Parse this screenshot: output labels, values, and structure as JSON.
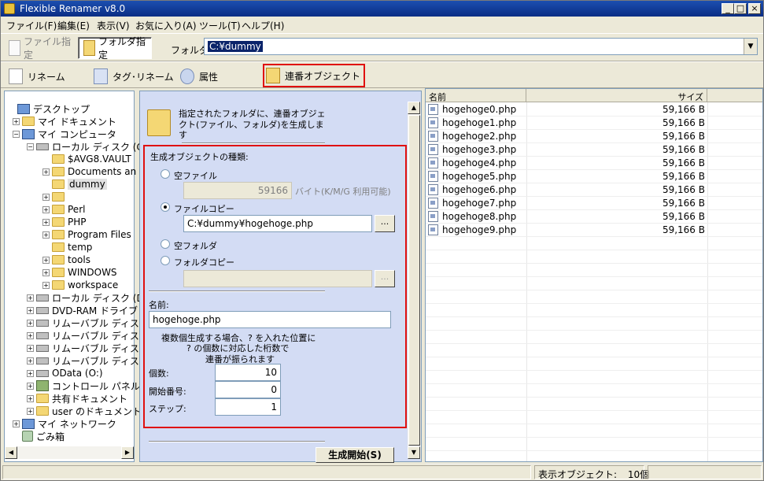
{
  "window": {
    "title": "Flexible Renamer v8.0",
    "min": "_",
    "max": "□",
    "close": "×"
  },
  "menu": [
    "ファイル(F)",
    "編集(E)",
    "表示(V)",
    "お気に入り(A)",
    "ツール(T)",
    "ヘルプ(H)"
  ],
  "toolbar1": {
    "file_mode": "ファイル指定",
    "folder_mode": "フォルダ指定",
    "folder_label": "フォルダ",
    "folder_path": "C:¥dummy"
  },
  "toolbar2": {
    "rename": "リネーム",
    "tag_rename": "タグ･リネーム",
    "attribute": "属性",
    "sequential_object": "連番オブジェクト"
  },
  "tree": {
    "items": [
      {
        "label": "デスクトップ",
        "icon": "desktop-icon"
      },
      {
        "label": "マイ ドキュメント",
        "icon": "folder-icon"
      },
      {
        "label": "マイ コンピュータ",
        "icon": "computer-icon"
      },
      {
        "label": "ローカル ディスク (C:",
        "icon": "drive-icon"
      },
      {
        "label": "$AVG8.VAULT",
        "icon": "folder-icon"
      },
      {
        "label": "Documents an",
        "icon": "folder-icon"
      },
      {
        "label": "dummy",
        "icon": "folder-icon"
      },
      {
        "label": "",
        "icon": "folder-icon"
      },
      {
        "label": "Perl",
        "icon": "folder-icon"
      },
      {
        "label": "PHP",
        "icon": "folder-icon"
      },
      {
        "label": "Program Files",
        "icon": "folder-icon"
      },
      {
        "label": "temp",
        "icon": "folder-icon"
      },
      {
        "label": "tools",
        "icon": "folder-icon"
      },
      {
        "label": "WINDOWS",
        "icon": "folder-icon"
      },
      {
        "label": "workspace",
        "icon": "folder-icon"
      },
      {
        "label": "ローカル ディスク (D:",
        "icon": "drive-icon"
      },
      {
        "label": "DVD-RAM ドライブ",
        "icon": "dvd-drive-icon"
      },
      {
        "label": "リムーバブル ディスク",
        "icon": "removable-drive-icon"
      },
      {
        "label": "リムーバブル ディスク",
        "icon": "removable-drive-icon"
      },
      {
        "label": "リムーバブル ディスク",
        "icon": "removable-drive-icon"
      },
      {
        "label": "リムーバブル ディスク",
        "icon": "removable-drive-icon"
      },
      {
        "label": "OData (O:)",
        "icon": "network-drive-icon"
      },
      {
        "label": "コントロール パネル",
        "icon": "control-panel-icon"
      },
      {
        "label": "共有ドキュメント",
        "icon": "folder-icon"
      },
      {
        "label": "user のドキュメント",
        "icon": "folder-icon"
      },
      {
        "label": "マイ ネットワーク",
        "icon": "network-icon"
      },
      {
        "label": "ごみ箱",
        "icon": "recycle-bin-icon"
      }
    ]
  },
  "panel": {
    "description": "指定されたフォルダに、連番オブジェクト(ファイル、フォルダ)を生成します",
    "kind_title": "生成オブジェクトの種類:",
    "empty_file": "空ファイル",
    "empty_file_size": "59166",
    "size_unit": "バイト(K/M/G 利用可能)",
    "file_copy": "ファイルコピー",
    "file_copy_path": "C:¥dummy¥hogehoge.php",
    "browse": "...",
    "empty_folder": "空フォルダ",
    "folder_copy": "フォルダコピー",
    "folder_copy_path": "",
    "name_label": "名前:",
    "name_value": "hogehoge.php",
    "hint_line1": "複数個生成する場合、? を入れた位置に",
    "hint_line2": "? の個数に対応した桁数で",
    "hint_line3": "連番が振られます",
    "count_label": "個数:",
    "count_value": "10",
    "start_label": "開始番号:",
    "start_value": "0",
    "step_label": "ステップ:",
    "step_value": "1",
    "generate_button": "生成開始(S)"
  },
  "list": {
    "col_name": "名前",
    "col_size": "サイズ",
    "rows": [
      {
        "name": "hogehoge0.php",
        "size": "59,166 B"
      },
      {
        "name": "hogehoge1.php",
        "size": "59,166 B"
      },
      {
        "name": "hogehoge2.php",
        "size": "59,166 B"
      },
      {
        "name": "hogehoge3.php",
        "size": "59,166 B"
      },
      {
        "name": "hogehoge4.php",
        "size": "59,166 B"
      },
      {
        "name": "hogehoge5.php",
        "size": "59,166 B"
      },
      {
        "name": "hogehoge6.php",
        "size": "59,166 B"
      },
      {
        "name": "hogehoge7.php",
        "size": "59,166 B"
      },
      {
        "name": "hogehoge8.php",
        "size": "59,166 B"
      },
      {
        "name": "hogehoge9.php",
        "size": "59,166 B"
      }
    ]
  },
  "status": {
    "label": "表示オブジェクト:",
    "count": "10個"
  },
  "colors": {
    "titlebar": "#0a2d84",
    "highlight_border": "#e0100f",
    "panel_bg": "#d3dcf4"
  }
}
